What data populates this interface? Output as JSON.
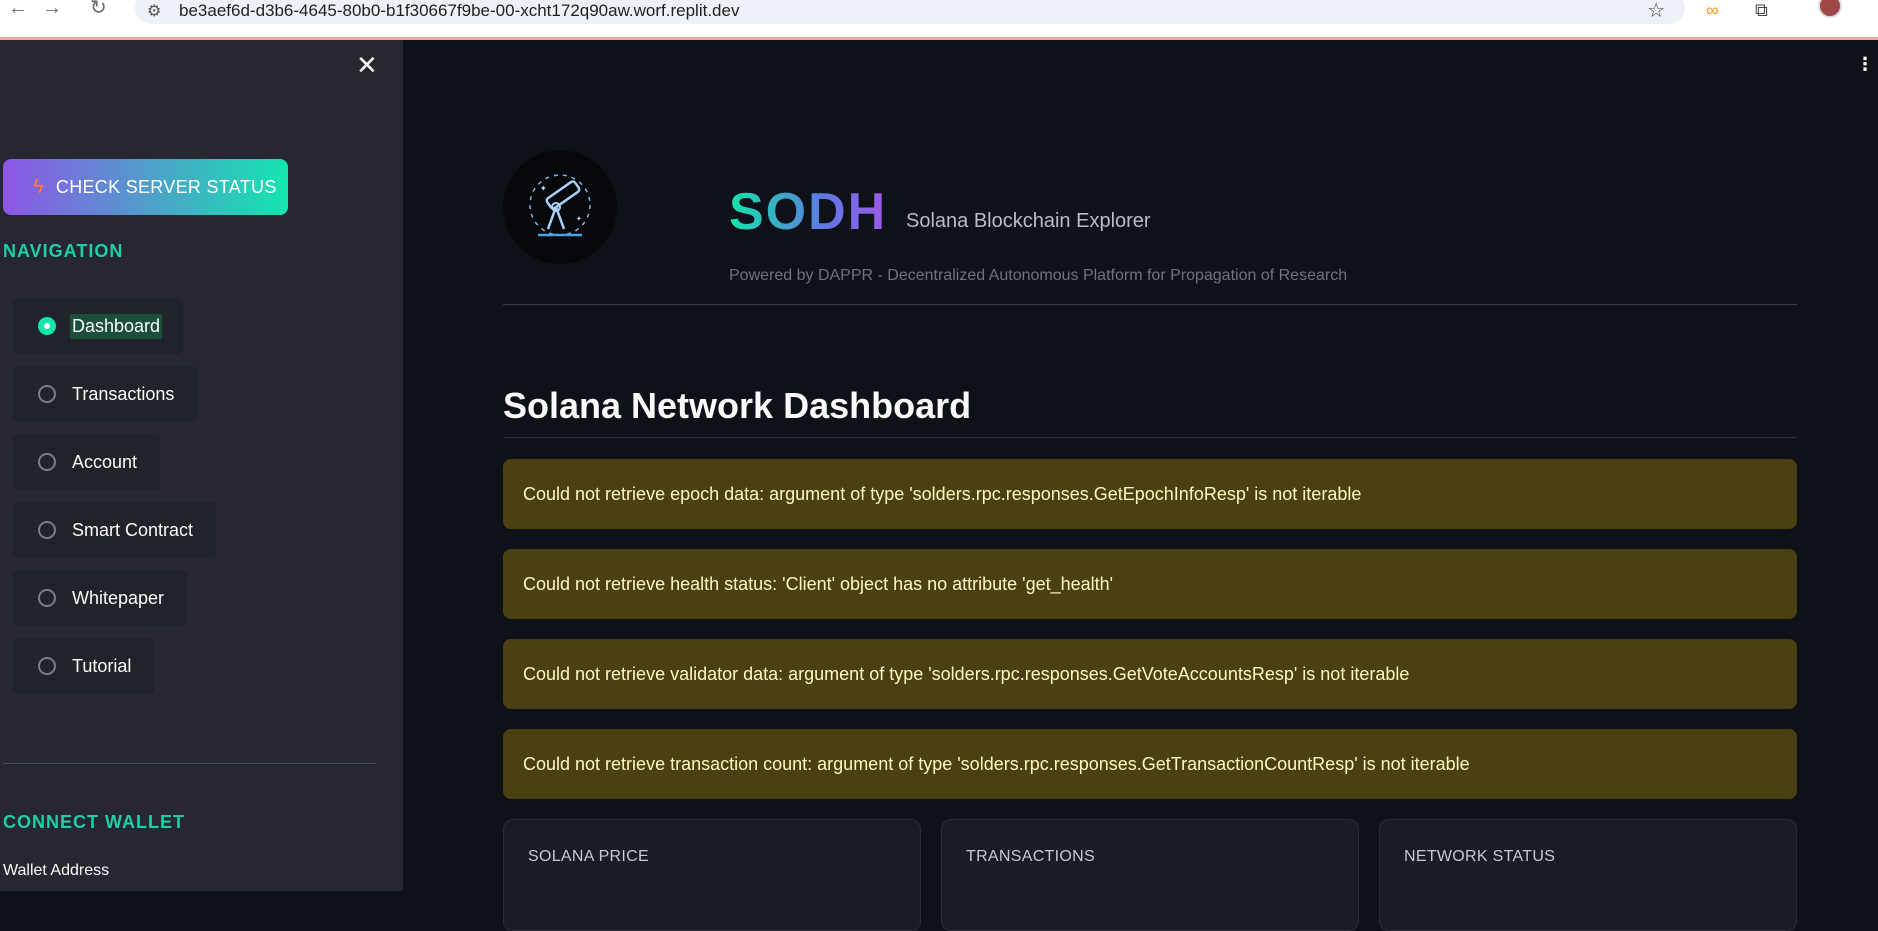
{
  "browser": {
    "url": "be3aef6d-d3b6-4645-80b0-b1f30667f9be-00-xcht172q90aw.worf.replit.dev"
  },
  "sidebar": {
    "status_button": "CHECK SERVER STATUS",
    "navigation_heading": "NAVIGATION",
    "nav_items": [
      {
        "label": "Dashboard",
        "selected": true
      },
      {
        "label": "Transactions",
        "selected": false
      },
      {
        "label": "Account",
        "selected": false
      },
      {
        "label": "Smart Contract",
        "selected": false
      },
      {
        "label": "Whitepaper",
        "selected": false
      },
      {
        "label": "Tutorial",
        "selected": false
      }
    ],
    "wallet_heading": "CONNECT WALLET",
    "wallet_address_label": "Wallet Address"
  },
  "header": {
    "brand": "SODH",
    "tagline": "Solana Blockchain Explorer",
    "powered_by": "Powered by DAPPR - Decentralized Autonomous Platform for Propagation of Research"
  },
  "main": {
    "title": "Solana Network Dashboard",
    "alerts": [
      "Could not retrieve epoch data: argument of type 'solders.rpc.responses.GetEpochInfoResp' is not iterable",
      "Could not retrieve health status: 'Client' object has no attribute 'get_health'",
      "Could not retrieve validator data: argument of type 'solders.rpc.responses.GetVoteAccountsResp' is not iterable",
      "Could not retrieve transaction count: argument of type 'solders.rpc.responses.GetTransactionCountResp' is not iterable"
    ],
    "metrics": [
      {
        "label": "SOLANA PRICE"
      },
      {
        "label": "TRANSACTIONS"
      },
      {
        "label": "NETWORK STATUS"
      }
    ]
  },
  "colors": {
    "accent": "#14e5a9",
    "sidebar_bg": "#262730",
    "main_bg": "#0e1117",
    "alert_bg": "#4a4012",
    "alert_text": "#fff6c2"
  }
}
